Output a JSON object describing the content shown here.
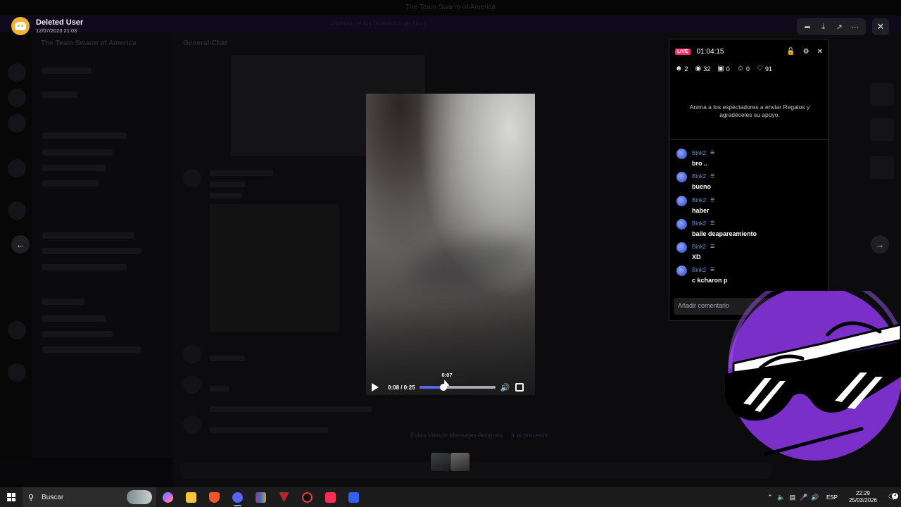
{
  "window": {
    "title": "The Team Swarm of America",
    "banner": "Disfruta de tus beneficios de Nitro"
  },
  "viewer": {
    "uploader_name": "Deleted User",
    "uploader_date": "12/07/2023 21:03"
  },
  "video": {
    "time_display": "0:08 / 0:25",
    "hover_time": "0:07",
    "progress_fraction": 0.32
  },
  "background": {
    "server_name": "The Team Swarm of America",
    "channel_header": "General-Chat",
    "hint_text": "Estás Viendo Mensajes Antiguos",
    "hint_link": "Ir al presente"
  },
  "live": {
    "badge": "LIVE",
    "duration": "01:04:15",
    "stats": {
      "guests": "2",
      "viewers": "32",
      "gifts": "0",
      "followers": "0",
      "likes": "91"
    },
    "gift_hint": "Anima a los espectadores a enviar Regalos y agradéceles su apoyo.",
    "comments": [
      {
        "user": "Bink2",
        "text": "bro .."
      },
      {
        "user": "Bink2",
        "text": "bueno"
      },
      {
        "user": "Bink2",
        "text": "haber"
      },
      {
        "user": "Bink2",
        "text": "baile deapareamiento"
      },
      {
        "user": "Bink2",
        "text": "XD"
      },
      {
        "user": "Bink2",
        "text": "c kcharon p"
      }
    ],
    "comment_placeholder": "Añadir comentario"
  },
  "taskbar": {
    "search_label": "Buscar",
    "language": "ESP",
    "time": "22:29",
    "date": "25/03/2026",
    "notifications": "4"
  },
  "colors": {
    "accent": "#5865f2",
    "live_badge": "#ff2d71",
    "sticker_purple": "#7a2fc8",
    "comment_username": "#5b8cff"
  }
}
